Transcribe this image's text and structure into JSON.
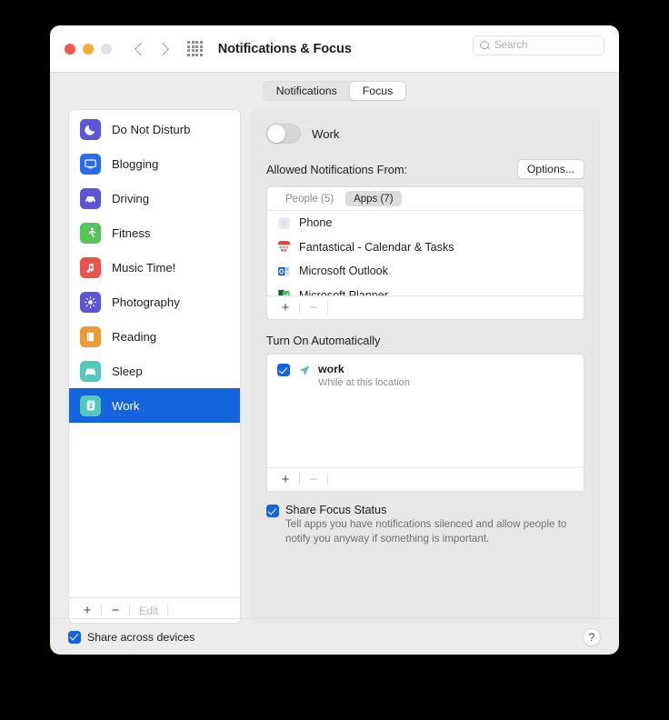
{
  "window": {
    "title": "Notifications & Focus",
    "traffic_lights": [
      "close",
      "minimize",
      "zoom"
    ],
    "back_label": "back",
    "forward_label": "forward",
    "grid_label": "show-all"
  },
  "search": {
    "placeholder": "Search"
  },
  "tabs": [
    {
      "label": "Notifications",
      "active": false
    },
    {
      "label": "Focus",
      "active": true
    }
  ],
  "sidebar": {
    "items": [
      {
        "label": "Do Not Disturb",
        "icon": "moon-icon",
        "color": "#5a56d6",
        "selected": false
      },
      {
        "label": "Blogging",
        "icon": "monitor-icon",
        "color": "#2a6bec",
        "selected": false
      },
      {
        "label": "Driving",
        "icon": "car-icon",
        "color": "#5a56d6",
        "selected": false
      },
      {
        "label": "Fitness",
        "icon": "runner-icon",
        "color": "#56c45a",
        "selected": false
      },
      {
        "label": "Music Time!",
        "icon": "music-note-icon",
        "color": "#e8534a",
        "selected": false
      },
      {
        "label": "Photography",
        "icon": "sun-icon",
        "color": "#5a56d6",
        "selected": false
      },
      {
        "label": "Reading",
        "icon": "book-icon",
        "color": "#f09a35",
        "selected": false
      },
      {
        "label": "Sleep",
        "icon": "bed-icon",
        "color": "#53c9bb",
        "selected": false
      },
      {
        "label": "Work",
        "icon": "id-badge-icon",
        "color": "#53c9bb",
        "selected": true
      }
    ],
    "footer": {
      "add": "+",
      "remove": "−",
      "edit": "Edit",
      "edit_disabled": true
    },
    "selection_color": "#1464e0"
  },
  "pane": {
    "focus_toggle": {
      "label": "Work",
      "on": false
    },
    "allowed": {
      "title": "Allowed Notifications From:",
      "options_button": "Options...",
      "segments": [
        {
          "label": "People (5)",
          "active": false
        },
        {
          "label": "Apps (7)",
          "active": true
        }
      ],
      "apps": [
        {
          "name": "Phone",
          "icon": "phone-app-icon"
        },
        {
          "name": "Fantastical - Calendar & Tasks",
          "icon": "fantastical-app-icon"
        },
        {
          "name": "Microsoft Outlook",
          "icon": "outlook-app-icon"
        },
        {
          "name": "Microsoft Planner",
          "icon": "planner-app-icon"
        }
      ],
      "footer": {
        "add": "+",
        "remove": "−"
      }
    },
    "automatic": {
      "title": "Turn On Automatically",
      "rows": [
        {
          "checked": true,
          "icon": "location-arrow-icon",
          "title": "work",
          "subtitle": "While at this location"
        }
      ],
      "footer": {
        "add": "+",
        "remove": "−"
      }
    },
    "share_focus_status": {
      "checked": true,
      "label": "Share Focus Status",
      "description": "Tell apps you have notifications silenced and allow people to notify you anyway if something is important."
    }
  },
  "bottom": {
    "share_across_devices": {
      "checked": true,
      "label": "Share across devices"
    },
    "help_label": "?"
  }
}
